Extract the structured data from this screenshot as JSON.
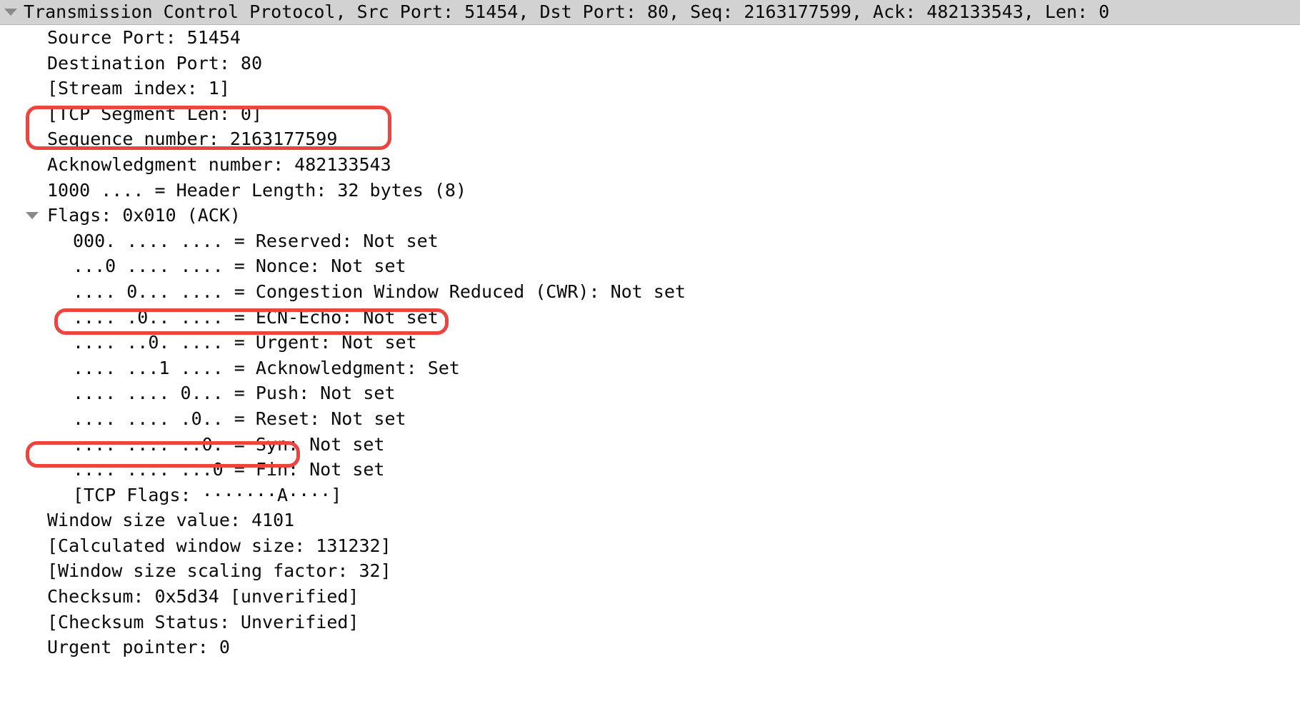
{
  "panel": {
    "name": "wireshark-packet-details",
    "protocol_header": {
      "text": "Transmission Control Protocol, Src Port: 51454, Dst Port: 80, Seq: 2163177599, Ack: 482133543, Len: 0",
      "expanded": true,
      "twisty_icon": "triangle-down-icon",
      "background": "#d2d2d2"
    },
    "fields": [
      {
        "text": "Source Port: 51454",
        "indent": 1
      },
      {
        "text": "Destination Port: 80",
        "indent": 1
      },
      {
        "text": "[Stream index: 1]",
        "indent": 1
      },
      {
        "text": "[TCP Segment Len: 0]",
        "indent": 1
      },
      {
        "text": "Sequence number: 2163177599",
        "indent": 1
      },
      {
        "text": "Acknowledgment number: 482133543",
        "indent": 1
      },
      {
        "text": "1000 .... = Header Length: 32 bytes (8)",
        "indent": 1
      },
      {
        "text": "Flags: 0x010 (ACK)",
        "indent": 1,
        "twisty": "triangle-down-icon"
      },
      {
        "text": "000. .... .... = Reserved: Not set",
        "indent": 2
      },
      {
        "text": "...0 .... .... = Nonce: Not set",
        "indent": 2
      },
      {
        "text": ".... 0... .... = Congestion Window Reduced (CWR): Not set",
        "indent": 2
      },
      {
        "text": ".... .0.. .... = ECN-Echo: Not set",
        "indent": 2
      },
      {
        "text": ".... ..0. .... = Urgent: Not set",
        "indent": 2
      },
      {
        "text": ".... ...1 .... = Acknowledgment: Set",
        "indent": 2
      },
      {
        "text": ".... .... 0... = Push: Not set",
        "indent": 2
      },
      {
        "text": ".... .... .0.. = Reset: Not set",
        "indent": 2
      },
      {
        "text": ".... .... ..0. = Syn: Not set",
        "indent": 2
      },
      {
        "text": ".... .... ...0 = Fin: Not set",
        "indent": 2
      },
      {
        "text": "[TCP Flags: ·······A····]",
        "indent": 2
      },
      {
        "text": "Window size value: 4101",
        "indent": 1
      },
      {
        "text": "[Calculated window size: 131232]",
        "indent": 1
      },
      {
        "text": "[Window size scaling factor: 32]",
        "indent": 1
      },
      {
        "text": "Checksum: 0x5d34 [unverified]",
        "indent": 1
      },
      {
        "text": "[Checksum Status: Unverified]",
        "indent": 1
      },
      {
        "text": "Urgent pointer: 0",
        "indent": 1
      }
    ]
  },
  "annotations": {
    "color": "#ea453f",
    "boxes": [
      {
        "id": "annot-seq-ack",
        "name": "annotation-box-sequence-acknowledgment-numbers"
      },
      {
        "id": "annot-ack-flag",
        "name": "annotation-box-acknowledgment-flag"
      },
      {
        "id": "annot-window",
        "name": "annotation-box-window-size-value"
      }
    ]
  }
}
